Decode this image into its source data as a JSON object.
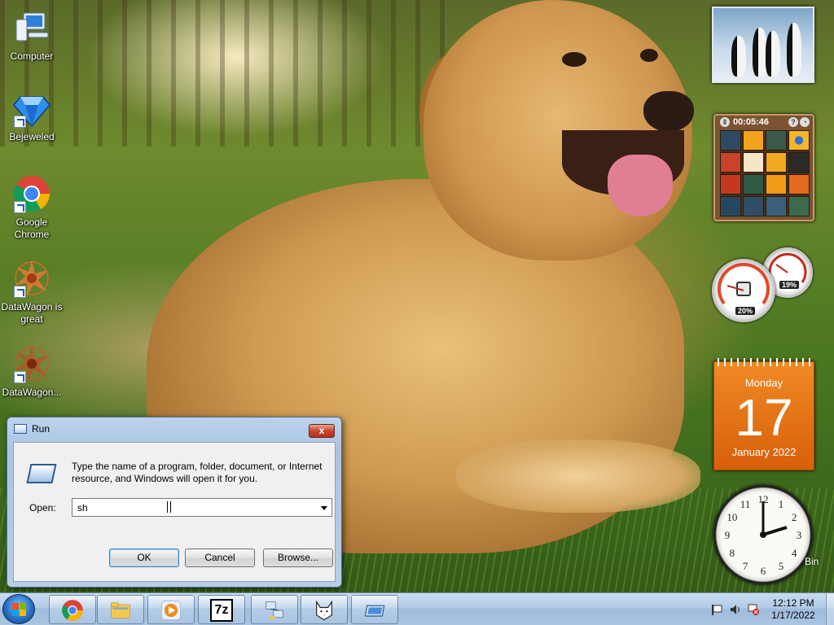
{
  "desktop": {
    "icons": [
      {
        "label": "Computer"
      },
      {
        "label": "Bejeweled"
      },
      {
        "label": "Google Chrome"
      },
      {
        "label": "DataWagon is great"
      },
      {
        "label": "DataWagon..."
      }
    ],
    "recycle_bin_partial_label": "Bin"
  },
  "gadgets": {
    "puzzle_timer": "00:05:46",
    "puzzle_help": "?",
    "puzzle_picture_btn": "◔",
    "meter_cpu_value": "20%",
    "meter_memory_value": "19%",
    "calendar": {
      "weekday": "Monday",
      "day": "17",
      "month_year": "January 2022"
    },
    "clock_numerals": [
      "12",
      "1",
      "2",
      "3",
      "4",
      "5",
      "6",
      "7",
      "8",
      "9",
      "10",
      "11"
    ]
  },
  "run_dialog": {
    "title": "Run",
    "close_glyph": "x",
    "description": "Type the name of a program, folder, document, or Internet resource, and Windows will open it for you.",
    "open_label": "Open:",
    "open_value": "sh",
    "ok_label": "OK",
    "cancel_label": "Cancel",
    "browse_label": "Browse..."
  },
  "taskbar": {
    "pinned": [
      "Google Chrome",
      "Windows Explorer",
      "Windows Media Player",
      "7-Zip",
      "Network",
      "Cat app",
      "Run"
    ],
    "tray_time": "12:12 PM",
    "tray_date": "1/17/2022",
    "archive_label": "7z"
  },
  "colors": {
    "calendar_orange": "#e8741a",
    "taskbar_blue": "#b2cbe5",
    "close_red": "#c7452b"
  }
}
